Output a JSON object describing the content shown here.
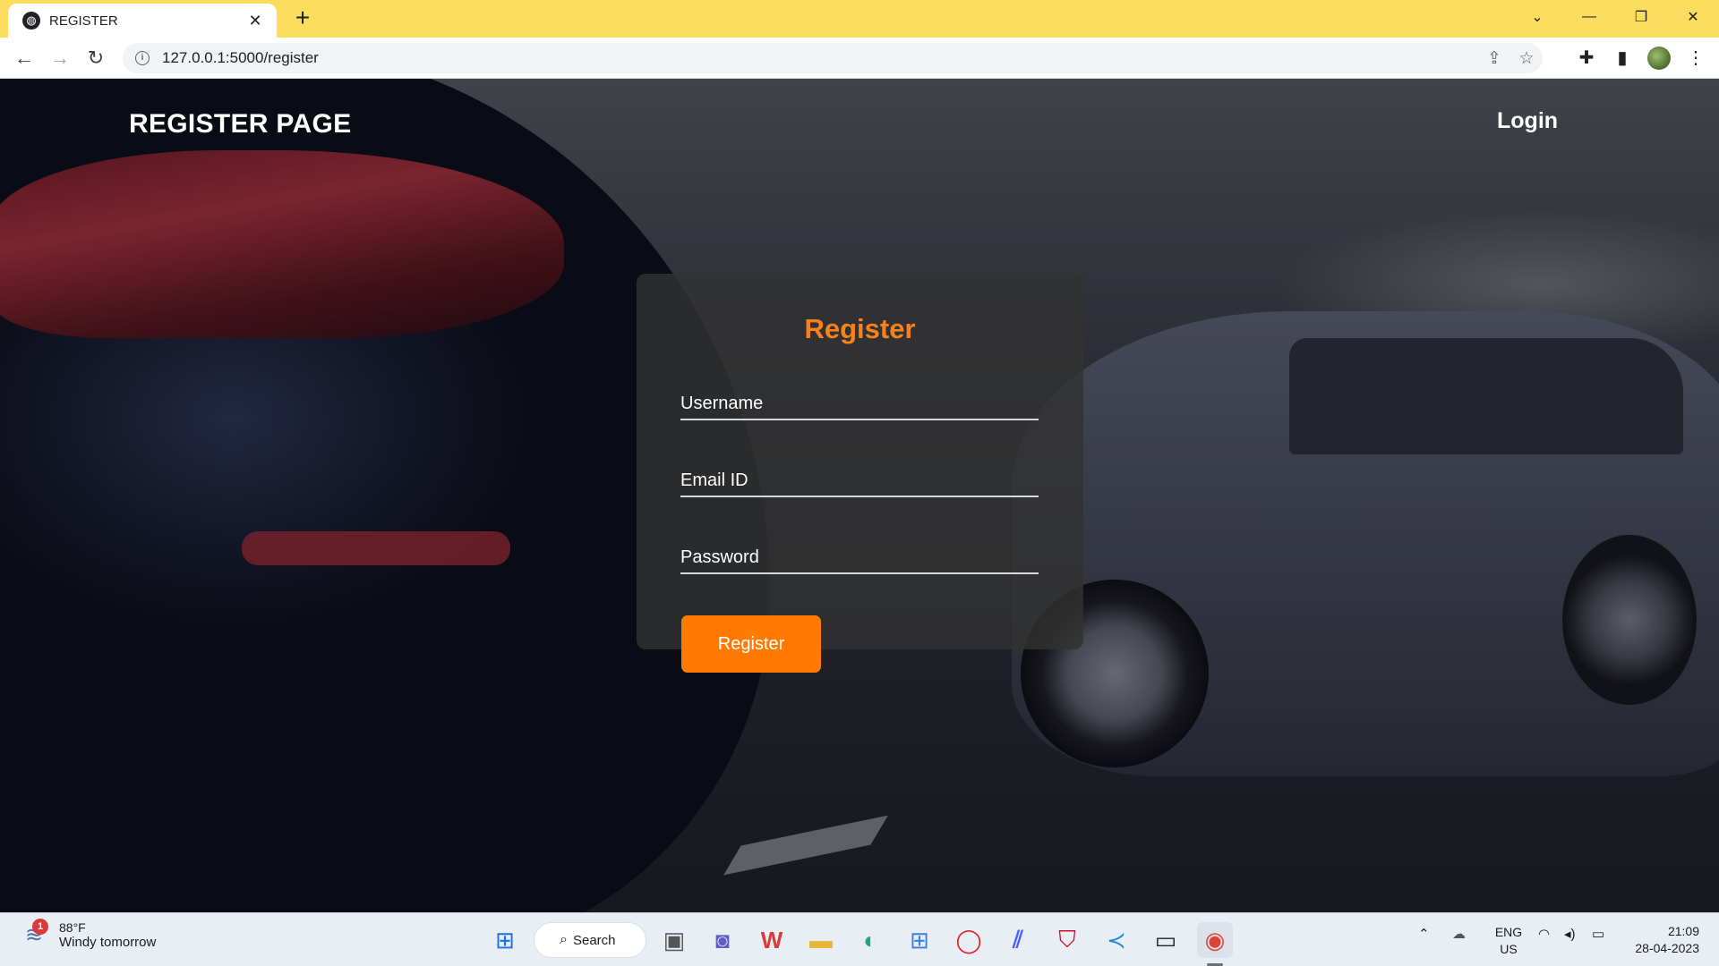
{
  "browser": {
    "tab_title": "REGISTER",
    "tab_close": "✕",
    "new_tab": "+",
    "url": "127.0.0.1:5000/register",
    "window_controls": [
      "⌄",
      "—",
      "❐",
      "✕"
    ]
  },
  "page": {
    "site_title": "REGISTER PAGE",
    "nav_login": "Login",
    "form": {
      "title": "Register",
      "username_placeholder": "Username",
      "email_placeholder": "Email ID",
      "password_placeholder": "Password",
      "submit_label": "Register"
    }
  },
  "taskbar": {
    "weather_temp": "88°F",
    "weather_desc": "Windy tomorrow",
    "weather_badge": "1",
    "search_label": "Search",
    "lang_top": "ENG",
    "lang_bottom": "US",
    "time": "21:09",
    "date": "28-04-2023"
  },
  "colors": {
    "accent": "#ff7a00",
    "title_orange": "#f7821b",
    "tabbar": "#fcdc5c"
  }
}
